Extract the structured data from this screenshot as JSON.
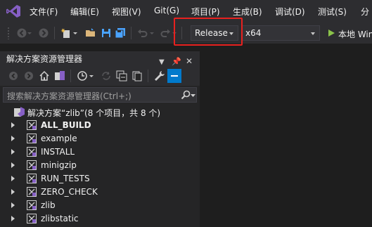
{
  "menu": {
    "items": [
      {
        "label": "文件(F)"
      },
      {
        "label": "编辑(E)"
      },
      {
        "label": "视图(V)"
      },
      {
        "label": "Git(G)"
      },
      {
        "label": "项目(P)"
      },
      {
        "label": "生成(B)"
      },
      {
        "label": "调试(D)"
      },
      {
        "label": "测试(S)"
      },
      {
        "label": "分"
      }
    ]
  },
  "toolbar": {
    "configuration": "Release",
    "platform": "x64",
    "run_label": "本地 Win"
  },
  "solution_explorer": {
    "title": "解决方案资源管理器",
    "search_placeholder": "搜索解决方案资源管理器(Ctrl+;)",
    "solution_label": "解决方案“zlib”(8 个项目，共 8 个)",
    "projects": [
      {
        "label": "ALL_BUILD"
      },
      {
        "label": "example"
      },
      {
        "label": "INSTALL"
      },
      {
        "label": "minigzip"
      },
      {
        "label": "RUN_TESTS"
      },
      {
        "label": "ZERO_CHECK"
      },
      {
        "label": "zlib"
      },
      {
        "label": "zlibstatic"
      }
    ]
  },
  "colors": {
    "accent_purple": "#865fc5",
    "highlight_red": "#e8211f",
    "run_green": "#8bc34a"
  }
}
